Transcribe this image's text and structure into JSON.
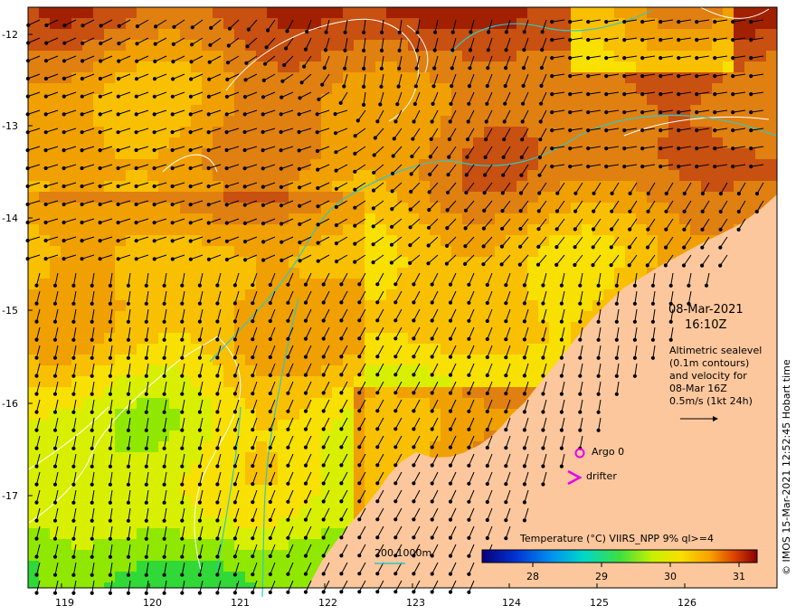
{
  "map": {
    "timestamp": {
      "date": "08-Mar-2021",
      "time": "16:10Z"
    },
    "altimetry_note": [
      "Altimetric sealevel",
      "(0.1m contours)",
      "and velocity for",
      "08-Mar 16Z",
      "0.5m/s (1kt 24h)"
    ],
    "legend": {
      "argo": "Argo 0",
      "drifter": "drifter"
    },
    "bathymetry_legend": "200  1000m",
    "colorbar": {
      "title": "Temperature (°C) VIIRS_NPP 9% ql>=4",
      "ticks": [
        "28",
        "29",
        "30",
        "31"
      ]
    },
    "lat_ticks": [
      "-12",
      "-13",
      "-14",
      "-15",
      "-16",
      "-17"
    ],
    "lon_ticks": [
      "119",
      "120",
      "121",
      "122",
      "123",
      "124",
      "125",
      "126"
    ],
    "credit": "© IMOS 15-Mar-2021 12:52:45 Hobart time",
    "colors": {
      "land": "#fcc79d",
      "argo_marker": "#e800e8",
      "drifter_marker": "#e800e8",
      "bathymetry_line": "#2fc7c7",
      "contour_line": "#ffffff"
    }
  }
}
